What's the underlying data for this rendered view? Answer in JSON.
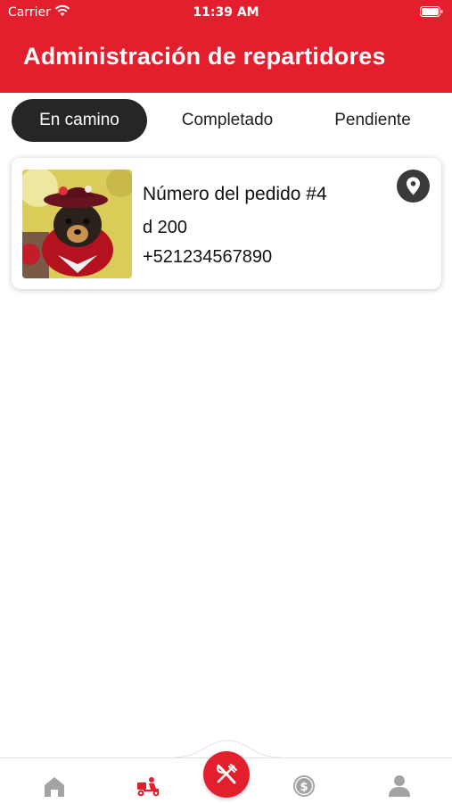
{
  "status_bar": {
    "carrier": "Carrier",
    "time": "11:39 AM",
    "wifi_icon": "wifi-icon",
    "battery_icon": "battery-icon"
  },
  "header": {
    "title": "Administración de repartidores",
    "background_color": "#e41f2d"
  },
  "tabs": [
    {
      "label": "En camino",
      "selected": true
    },
    {
      "label": "Completado",
      "selected": false
    },
    {
      "label": "Pendiente",
      "selected": false
    }
  ],
  "orders": [
    {
      "title": "Número del pedido #4",
      "amount": "d 200",
      "phone": "+521234567890",
      "photo": "dog-in-costume-photo",
      "action_icon": "map-pin-icon"
    }
  ],
  "bottom_nav": {
    "items": [
      {
        "icon": "home-icon",
        "active": false
      },
      {
        "icon": "delivery-scooter-icon",
        "active": true
      },
      {
        "icon": "fork-knife-icon",
        "active": false,
        "center": true
      },
      {
        "icon": "dollar-coin-icon",
        "active": false
      },
      {
        "icon": "user-icon",
        "active": false
      }
    ]
  },
  "colors": {
    "accent": "#e41f2d",
    "tab_active_bg": "#262626",
    "icon_inactive": "#a3a3a3"
  }
}
